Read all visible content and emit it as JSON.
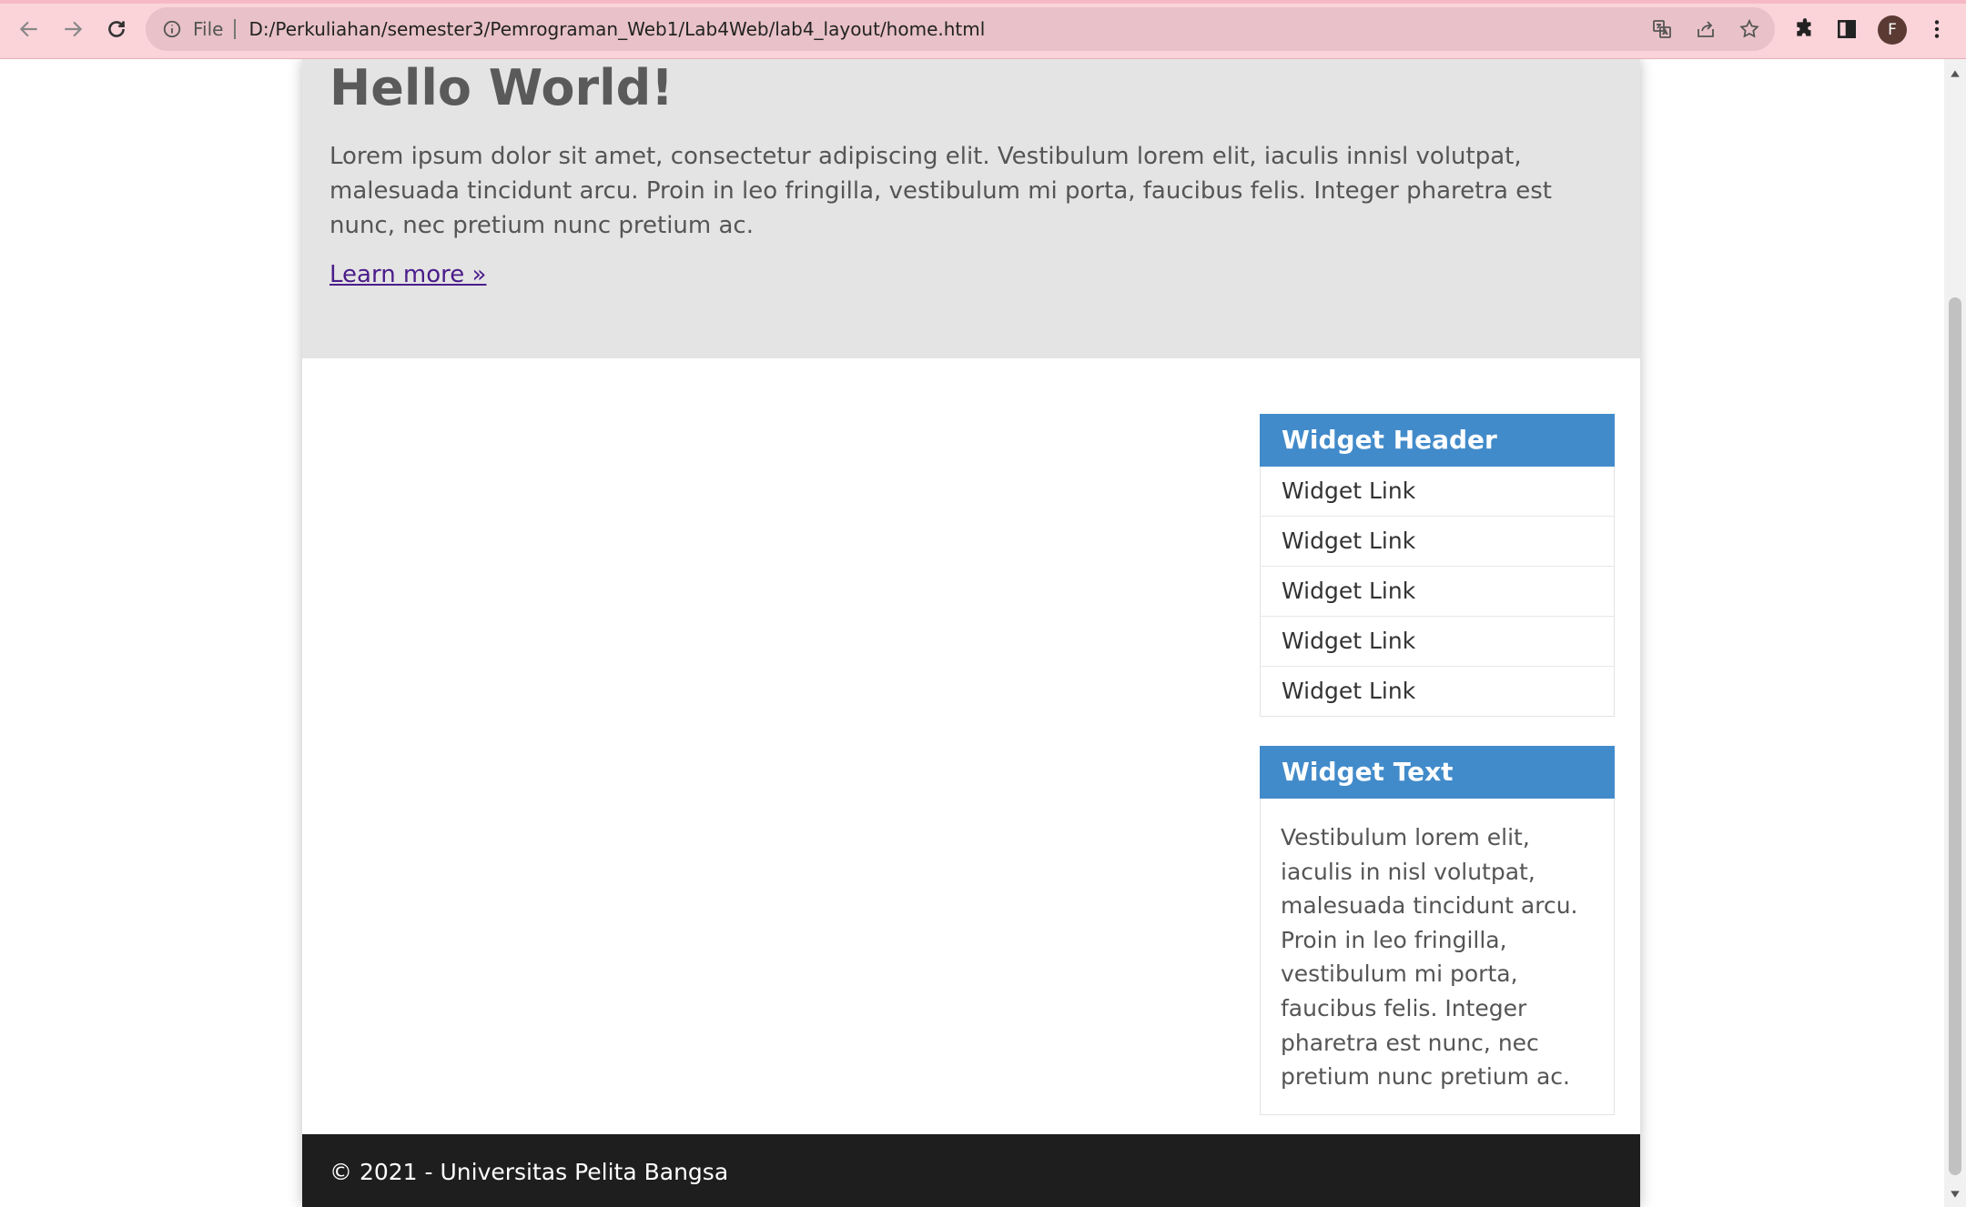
{
  "browser": {
    "scheme_label": "File",
    "url": "D:/Perkuliahan/semester3/Pemrograman_Web1/Lab4Web/lab4_layout/home.html",
    "profile_initial": "F",
    "icons": {
      "back": "arrow-left-icon",
      "forward": "arrow-right-icon",
      "reload": "reload-icon",
      "site_info": "info-icon",
      "translate": "translate-icon",
      "share": "share-icon",
      "bookmark": "star-icon",
      "extensions": "puzzle-icon",
      "side_panel": "side-panel-icon",
      "menu": "kebab-menu-icon"
    }
  },
  "hero": {
    "title": "Hello World!",
    "body": "Lorem ipsum dolor sit amet, consectetur adipiscing elit. Vestibulum lorem elit, iaculis innisl volutpat, malesuada tincidunt arcu. Proin in leo fringilla, vestibulum mi porta, faucibus felis. Integer pharetra est nunc, nec pretium nunc pretium ac.",
    "link": "Learn more »"
  },
  "sidebar": {
    "links_widget": {
      "header": "Widget Header",
      "links": [
        "Widget Link",
        "Widget Link",
        "Widget Link",
        "Widget Link",
        "Widget Link"
      ]
    },
    "text_widget": {
      "header": "Widget Text",
      "body": "Vestibulum lorem elit, iaculis in nisl volutpat, malesuada tincidunt arcu. Proin in leo fringilla, vestibulum mi porta, faucibus felis. Integer pharetra est nunc, nec pretium nunc pretium ac."
    }
  },
  "footer": {
    "text": "© 2021 - Universitas Pelita Bangsa"
  },
  "colors": {
    "chrome_bg": "#fbd4da",
    "hero_bg": "#e4e4e4",
    "widget_header_bg": "#428bca",
    "footer_bg": "#1e1e1e",
    "link": "#4b1d8a"
  }
}
